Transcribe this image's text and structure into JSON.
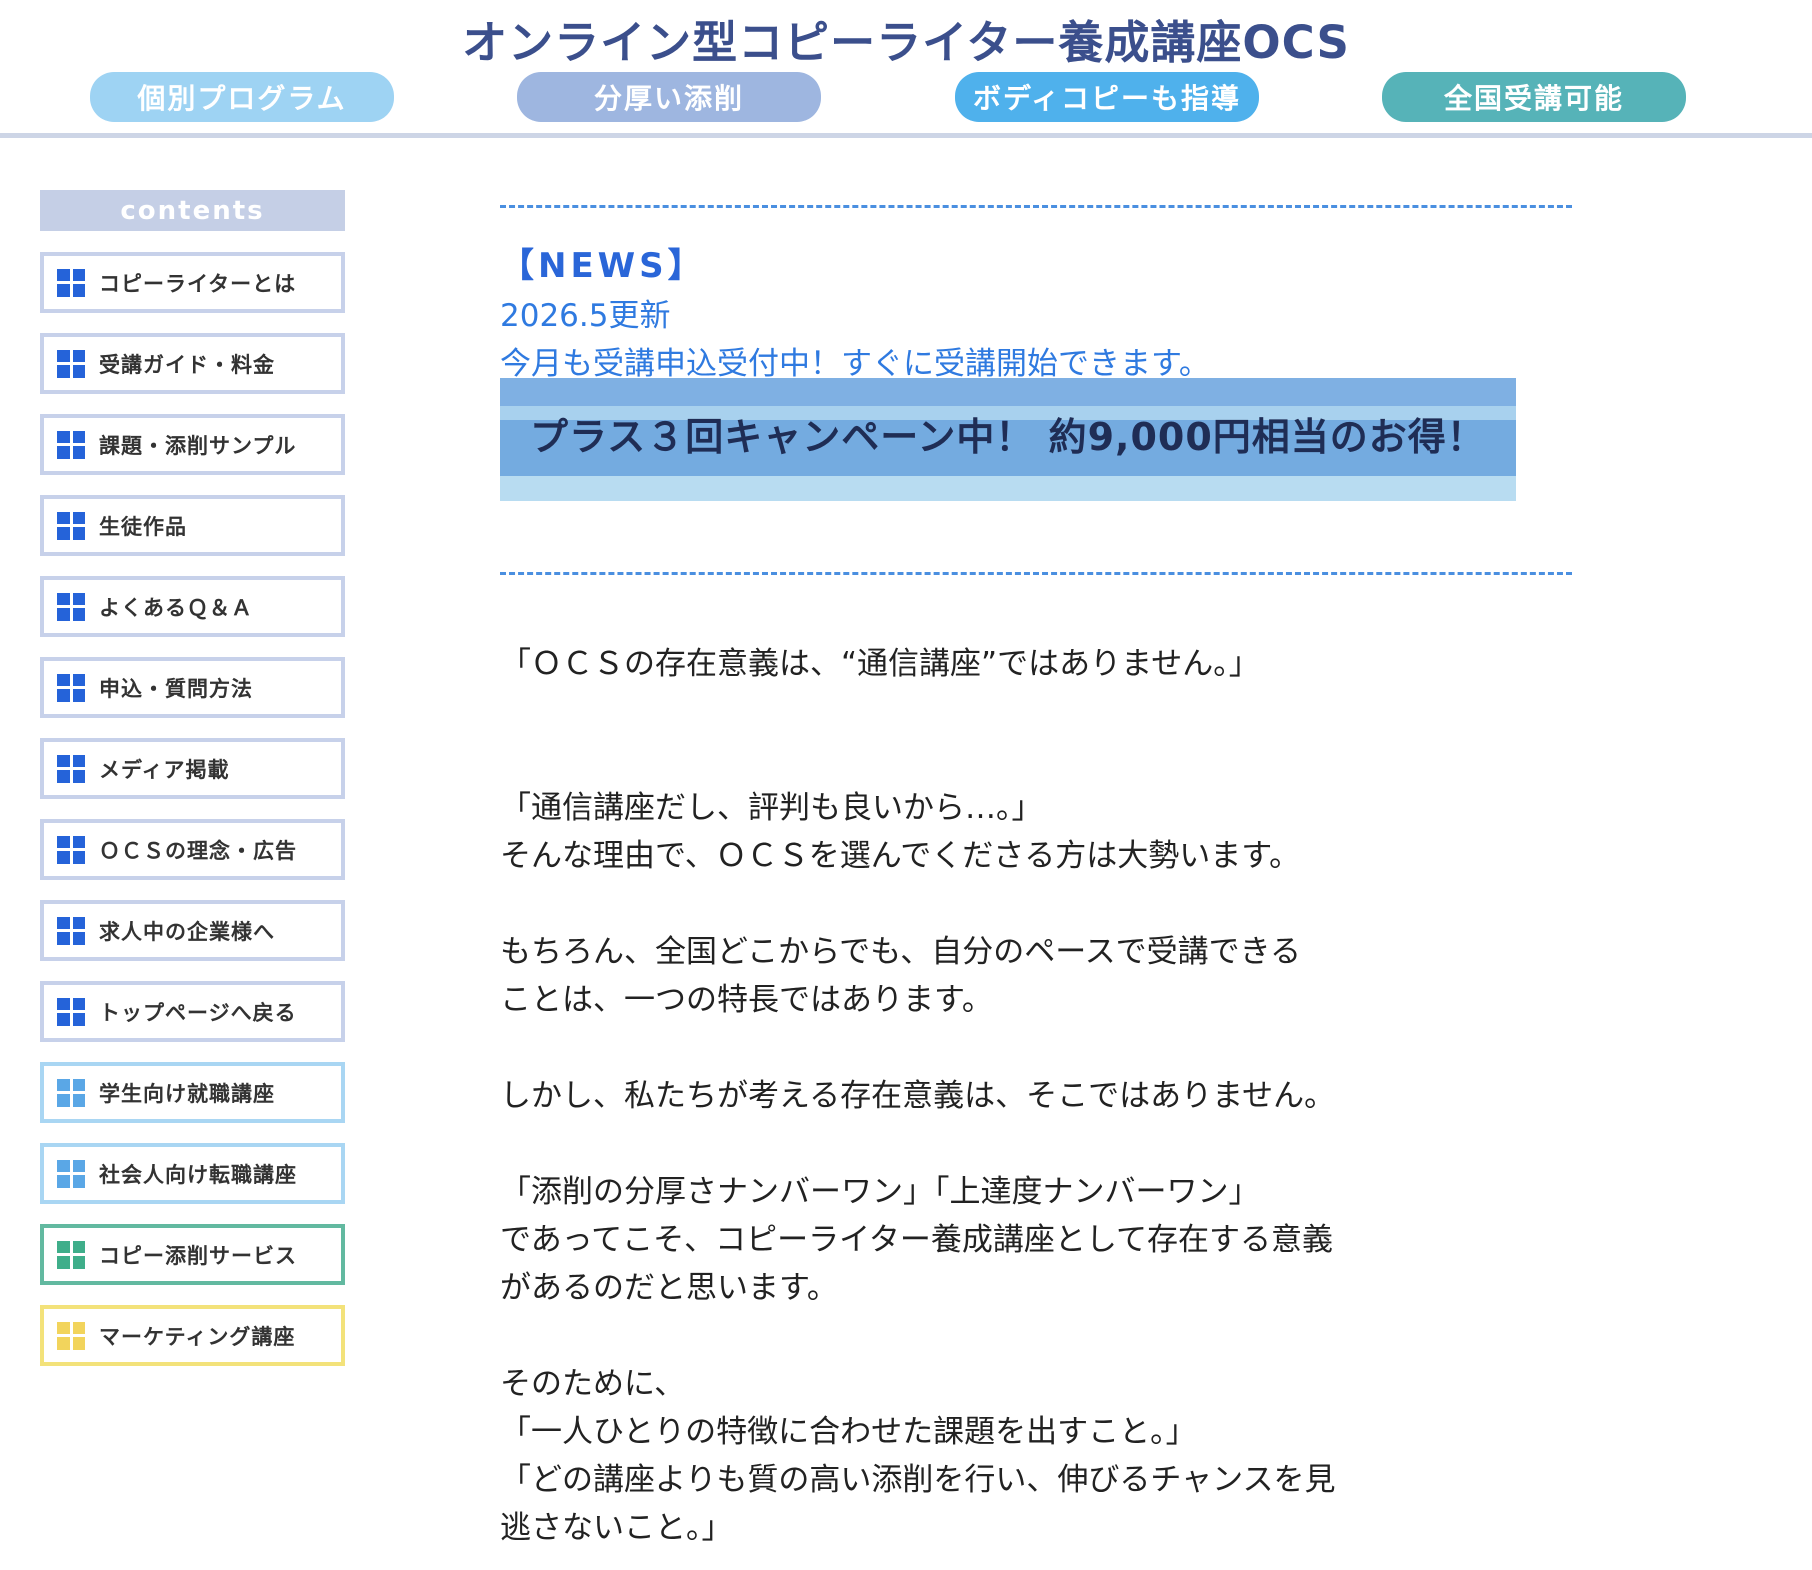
{
  "header": {
    "site_title": "オンライン型コピーライター養成講座OCS",
    "tabs": [
      {
        "label": "個別プログラム",
        "color": "#9ed3f3"
      },
      {
        "label": "分厚い添削",
        "color": "#9eb6e0"
      },
      {
        "label": "ボディコピーも指導",
        "color": "#4fb1ec"
      },
      {
        "label": "全国受講可能",
        "color": "#56b3b8"
      }
    ]
  },
  "sidebar": {
    "header": "contents",
    "items": [
      {
        "label": "コピーライターとは",
        "icon": "grid-icon",
        "icon_color": "#2563d9",
        "border_color": "#c7d1ea"
      },
      {
        "label": "受講ガイド・料金",
        "icon": "grid-icon",
        "icon_color": "#2563d9",
        "border_color": "#c7d1ea"
      },
      {
        "label": "課題・添削サンプル",
        "icon": "grid-icon",
        "icon_color": "#2563d9",
        "border_color": "#c7d1ea"
      },
      {
        "label": "生徒作品",
        "icon": "grid-icon",
        "icon_color": "#2563d9",
        "border_color": "#c7d1ea"
      },
      {
        "label": "よくあるＱ＆Ａ",
        "icon": "grid-icon",
        "icon_color": "#2563d9",
        "border_color": "#c7d1ea"
      },
      {
        "label": "申込・質問方法",
        "icon": "grid-icon",
        "icon_color": "#2563d9",
        "border_color": "#c7d1ea"
      },
      {
        "label": "メディア掲載",
        "icon": "grid-icon",
        "icon_color": "#2563d9",
        "border_color": "#c7d1ea"
      },
      {
        "label": "ＯＣＳの理念・広告",
        "icon": "grid-icon",
        "icon_color": "#2563d9",
        "border_color": "#c7d1ea"
      },
      {
        "label": "求人中の企業様へ",
        "icon": "grid-icon",
        "icon_color": "#2563d9",
        "border_color": "#c7d1ea"
      },
      {
        "label": "トップページへ戻る",
        "icon": "grid-icon",
        "icon_color": "#2563d9",
        "border_color": "#c7d1ea"
      },
      {
        "label": "学生向け就職講座",
        "icon": "grid-icon",
        "icon_color": "#5aa7e6",
        "border_color": "#a9d6f3"
      },
      {
        "label": "社会人向け転職講座",
        "icon": "grid-icon",
        "icon_color": "#5aa7e6",
        "border_color": "#a9d6f3"
      },
      {
        "label": "コピー添削サービス",
        "icon": "grid-icon",
        "icon_color": "#3fae8a",
        "border_color": "#62b9a0"
      },
      {
        "label": "マーケティング講座",
        "icon": "grid-icon",
        "icon_color": "#f2d45c",
        "border_color": "#f3e27a"
      }
    ]
  },
  "main": {
    "news_heading": "【NEWS】",
    "news_date": "2026.5更新",
    "news_text": "今月も受講申込受付中！すぐに受講開始できます。",
    "banner_text": "プラス３回キャンペーン中！ 約9,000円相当のお得！",
    "paragraphs": [
      {
        "lines": [
          "「ＯＣＳの存在意義は、“通信講座”ではありません。」"
        ]
      },
      {
        "lines": [
          "「通信講座だし、評判も良いから…。」",
          "そんな理由で、ＯＣＳを選んでくださる方は大勢います。"
        ]
      },
      {
        "lines": [
          "もちろん、全国どこからでも、自分のペースで受講できる",
          "ことは、一つの特長ではあります。"
        ]
      },
      {
        "lines": [
          "しかし、私たちが考える存在意義は、そこではありません。"
        ]
      },
      {
        "lines": [
          "「添削の分厚さナンバーワン」「上達度ナンバーワン」",
          "であってこそ、コピーライター養成講座として存在する意義",
          "があるのだと思います。"
        ]
      },
      {
        "lines": [
          "そのために、",
          "「一人ひとりの特徴に合わせた課題を出すこと。」",
          "「どの講座よりも質の高い添削を行い、伸びるチャンスを見",
          "逃さないこと。」"
        ]
      }
    ]
  }
}
